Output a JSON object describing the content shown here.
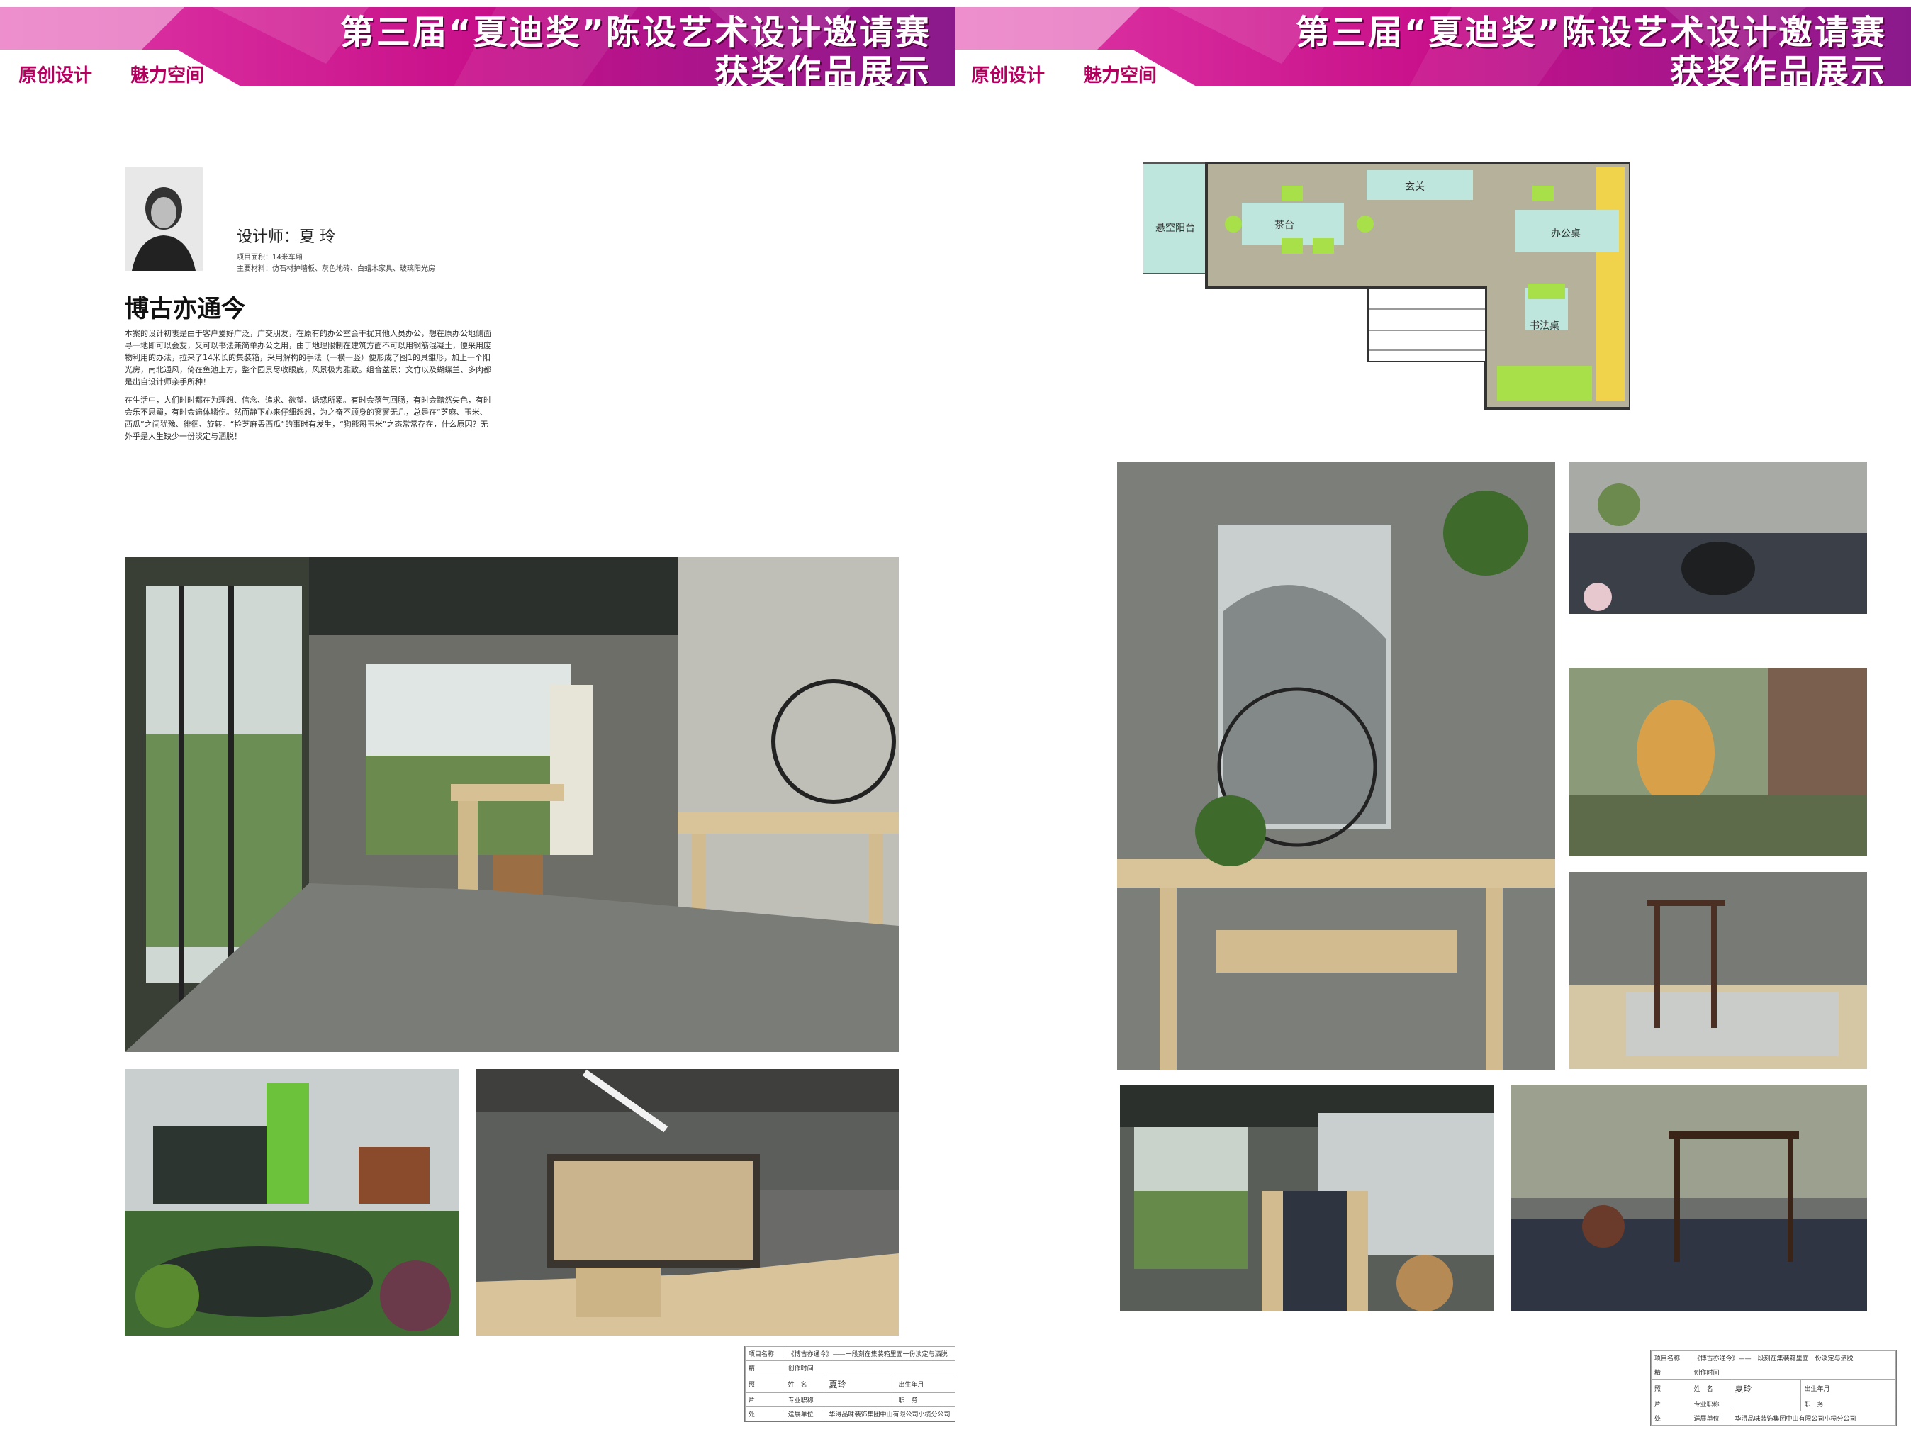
{
  "banner": {
    "title_line1": "第三届“夏迪奖”陈设艺术设计邀请赛",
    "title_line2": "获奖作品展示",
    "tag1": "原创设计",
    "tag2": "魅力空间",
    "colors": {
      "magenta": "#c8108a",
      "purple": "#7a1f8f",
      "tag": "#b3005e"
    }
  },
  "designer": {
    "name_line": "设计师：夏 玲",
    "area": "项目面积：14米车厢",
    "materials": "主要材料：仿石材护墙板、灰色地砖、白蜡木家具、玻璃阳光房"
  },
  "project": {
    "title": "博古亦通今",
    "para1": "本案的设计初衷是由于客户爱好广泛，广交朋友，在原有的办公室会干扰其他人员办公，想在原办公地侧面寻一地即可以会友，又可以书法兼简单办公之用，由于地理限制在建筑方面不可以用钢筋混凝土，便采用废物利用的办法，拉来了14米长的集装箱，采用解构的手法（一横一竖）便形成了图1的具雏形，加上一个阳光房，南北通风，倚在鱼池上方，整个园景尽收眼底，风景极为雅致。组合盆景：文竹以及蝴蝶兰、多肉都是出自设计师亲手所种！",
    "para2": "在生活中，人们时时都在为理想、信念、追求、欲望、诱惑所累。有时会落气回肠，有时会黯然失色，有时会乐不思蜀，有时会遍体鳞伤。然而静下心来仔细想想，为之奋不顾身的寥寥无几，总是在“芝麻、玉米、西瓜”之间犹豫、徘徊、旋转。“捡芝麻丢西瓜”的事时有发生，“狗熊掰玉米”之态常常存在，什么原因？无外乎是人生缺少一份淡定与洒脱！"
  },
  "floorplan": {
    "labels": {
      "balcony": "悬空阳台",
      "tea": "茶台",
      "entrance": "玄关",
      "office": "办公桌",
      "calligraphy": "书法桌"
    }
  },
  "table_left": {
    "r1c1": "项目名称",
    "r1c2": "《博古亦通今》——一段刻在集装箱里面一份淡定与洒脱",
    "v1": "精",
    "v2": "照",
    "v3": "片",
    "v4": "处",
    "r2": "创作时间",
    "r3a": "姓　名",
    "r3b": "夏玲",
    "r3c": "出生年月",
    "r4a": "专业职称",
    "r4b": "职　务",
    "r5a": "送展单位",
    "r5b": "华浔品味装饰集团中山有限公司小榄分公司"
  },
  "table_right": {
    "r1c1": "项目名称",
    "r1c2": "《博古亦通今》——一段刻在集装箱里面一份淡定与洒脱",
    "v1": "精",
    "v2": "照",
    "v3": "片",
    "v4": "处",
    "r2": "创作时间",
    "r3a": "姓　名",
    "r3b": "夏玲",
    "r3c": "出生年月",
    "r4a": "专业职称",
    "r4b": "职　务",
    "r5a": "送展单位",
    "r5b": "华浔品味装饰集团中山有限公司小榄分公司"
  }
}
